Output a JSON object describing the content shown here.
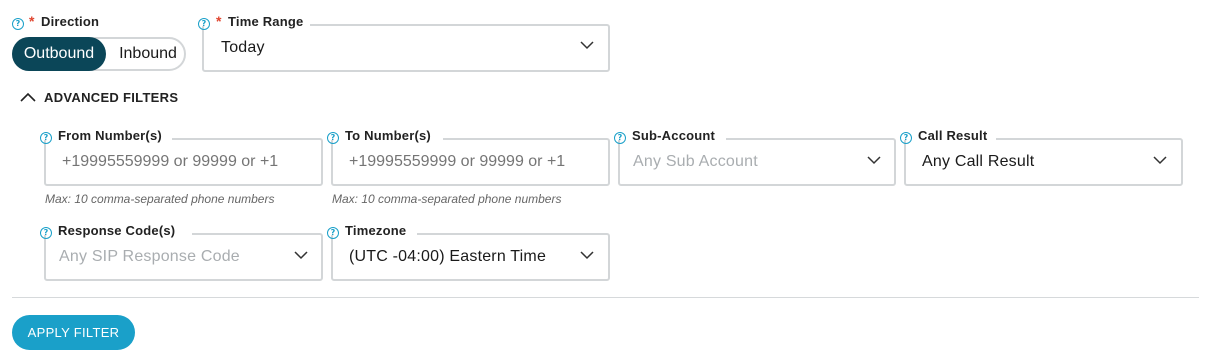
{
  "direction": {
    "required_mark": "*",
    "label": "Direction",
    "options": [
      "Outbound",
      "Inbound"
    ],
    "selected": "Outbound"
  },
  "time_range": {
    "required_mark": "*",
    "label": "Time Range",
    "value": "Today"
  },
  "advanced": {
    "toggle_label": "ADVANCED FILTERS"
  },
  "from_numbers": {
    "label": "From Number(s)",
    "placeholder": "+19995559999 or 99999 or +1",
    "hint": "Max: 10 comma-separated phone numbers"
  },
  "to_numbers": {
    "label": "To Number(s)",
    "placeholder": "+19995559999 or 99999 or +1",
    "hint": "Max: 10 comma-separated phone numbers"
  },
  "sub_account": {
    "label": "Sub-Account",
    "placeholder": "Any Sub Account"
  },
  "call_result": {
    "label": "Call Result",
    "value": "Any Call Result"
  },
  "response_codes": {
    "label": "Response Code(s)",
    "placeholder": "Any SIP Response Code"
  },
  "timezone": {
    "label": "Timezone",
    "value": "(UTC -04:00) Eastern Time"
  },
  "apply_button": {
    "label": "APPLY FILTER"
  },
  "colors": {
    "toggle_active_bg": "#0b4658",
    "apply_bg": "#1aa0c9",
    "required": "#e0452f",
    "help_icon": "#1aa0c9",
    "border": "#d3d6d8"
  },
  "help_icon_glyph": "?"
}
